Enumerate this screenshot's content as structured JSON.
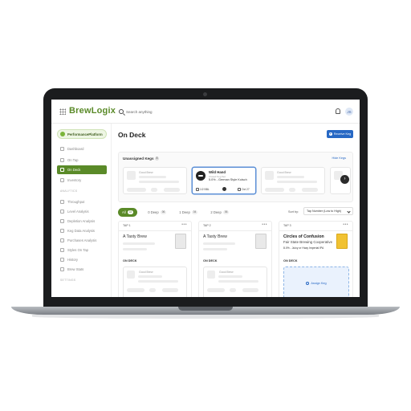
{
  "app": {
    "logo": "BrewLogix",
    "search_placeholder": "Search anything",
    "user_initial": "JS"
  },
  "sidebar": {
    "platform": "PerformancePlatform",
    "items": [
      {
        "label": "Dashboard",
        "active": false
      },
      {
        "label": "On Tap",
        "active": false
      },
      {
        "label": "On Deck",
        "active": true
      },
      {
        "label": "Inventory",
        "active": false
      }
    ],
    "analytics_label": "ANALYTICS",
    "analytics_items": [
      "Throughput",
      "Level Analysis",
      "Depletion Analysis",
      "Keg Data Analysis",
      "Purchases Analysis",
      "Styles On Tap",
      "History",
      "Brew Stats"
    ],
    "settings_label": "SETTINGS"
  },
  "header": {
    "title": "On Deck",
    "receive_label": "Receive Keg"
  },
  "unassigned": {
    "title": "Unassigned Kegs",
    "count": "8",
    "hide_label": "Hide Kegs",
    "cards": [
      {
        "brewery": "Good Brew",
        "selected": false
      },
      {
        "name": "Wild Hand",
        "sub": "Closed Keg Set",
        "desc": "5.0% - German Style Kolsch",
        "size": "1/2 BBL",
        "date": "Oct 27",
        "selected": true
      },
      {
        "brewery": "Good Brew",
        "selected": false
      },
      {
        "brewery": "Good Brew",
        "selected": false
      }
    ]
  },
  "filters": {
    "chips": [
      {
        "label": "All",
        "count": "18",
        "active": true
      },
      {
        "label": "0 Deep",
        "count": "06",
        "active": false
      },
      {
        "label": "1 Deep",
        "count": "04",
        "active": false
      },
      {
        "label": "2 Deep",
        "count": "06",
        "active": false
      }
    ],
    "sort_label": "Sort by:",
    "sort_value": "Tap Number (Low to High)"
  },
  "taps": [
    {
      "tap": "TAP 1",
      "name": "A Tasty Brew",
      "ondeck": "ON DECK",
      "card_brewery": "Good Brew"
    },
    {
      "tap": "TAP 2",
      "name": "A Tasty Brew",
      "ondeck": "ON DECK",
      "card_brewery": "Good Brew"
    },
    {
      "tap": "TAP 3",
      "name": "Circles of Confusion",
      "brewery": "Fair State Brewing Cooperative",
      "style": "8.0% - Juicy or Hazy Imperial IPA",
      "ondeck": "ON DECK",
      "assign_label": "Assign Keg"
    }
  ],
  "colors": {
    "brand_green": "#5a8a28",
    "accent_blue": "#2768c4",
    "keg_yellow": "#f1c232"
  }
}
